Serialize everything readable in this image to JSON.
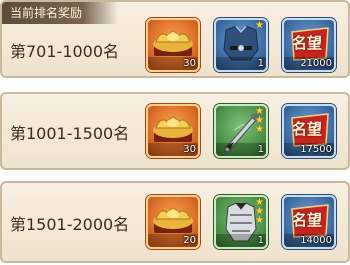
{
  "header": {
    "title": "当前排名奖励"
  },
  "colors": {
    "panel_bg": "#f2e7d4",
    "slot_orange": "#e0712a",
    "slot_blue": "#3e6fa6",
    "slot_green": "#4f944a",
    "star": "#ffd23c",
    "fame_red": "#c8241c"
  },
  "rows": [
    {
      "rank": "第701-1000名",
      "items": [
        {
          "icon": "gold-ingot-icon",
          "quality": "orange",
          "count": "30"
        },
        {
          "icon": "blue-armor-icon",
          "quality": "blue",
          "count": "1",
          "stars": 1
        },
        {
          "icon": "fame-badge-icon",
          "quality": "blue",
          "count": "21000",
          "badge_text": "名望"
        }
      ]
    },
    {
      "rank": "第1001-1500名",
      "items": [
        {
          "icon": "gold-ingot-icon",
          "quality": "orange",
          "count": "30"
        },
        {
          "icon": "saber-icon",
          "quality": "green",
          "count": "1",
          "stars": 3
        },
        {
          "icon": "fame-badge-icon",
          "quality": "blue",
          "count": "17500",
          "badge_text": "名望"
        }
      ]
    },
    {
      "rank": "第1501-2000名",
      "items": [
        {
          "icon": "gold-ingot-icon",
          "quality": "orange",
          "count": "20"
        },
        {
          "icon": "silver-armor-icon",
          "quality": "green",
          "count": "1",
          "stars": 3
        },
        {
          "icon": "fame-badge-icon",
          "quality": "blue",
          "count": "14000",
          "badge_text": "名望"
        }
      ]
    }
  ]
}
